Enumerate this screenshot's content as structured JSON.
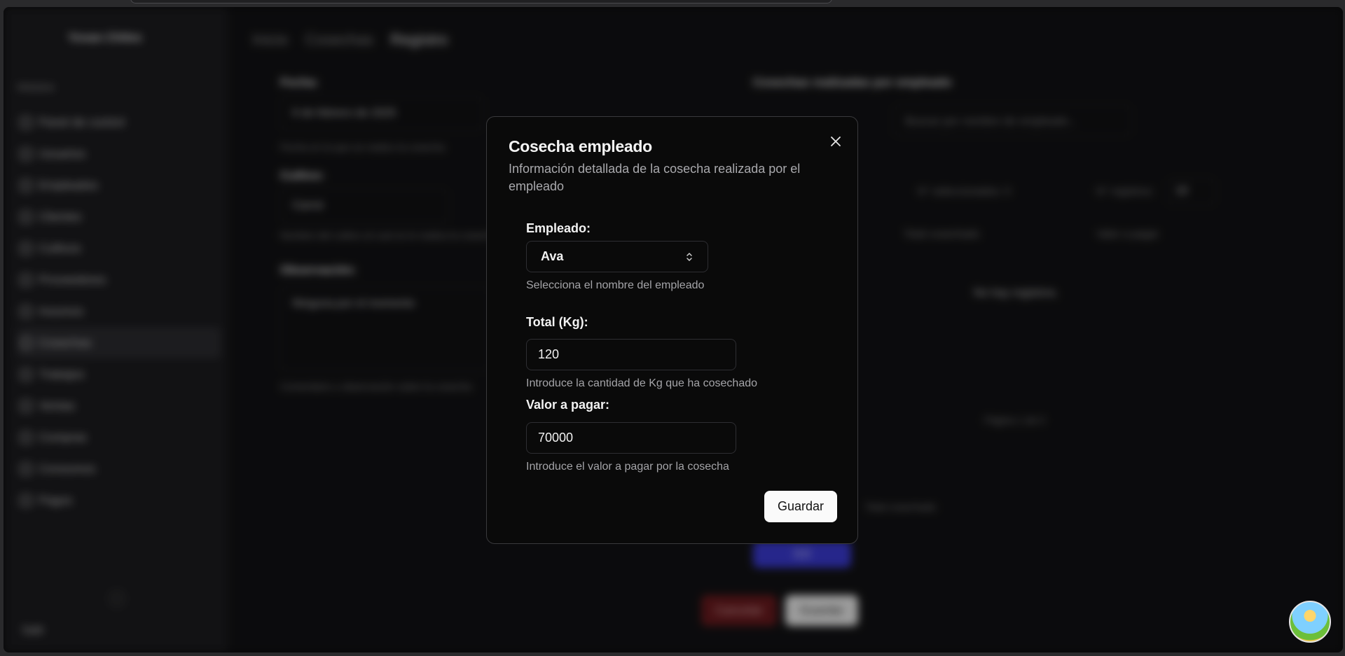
{
  "background": {
    "org_name": "Yovan Chiles",
    "sidebar_group": "Módulos",
    "nav": [
      {
        "label": "Panel de control",
        "active": false
      },
      {
        "label": "Usuarios",
        "active": false
      },
      {
        "label": "Empleados",
        "active": false
      },
      {
        "label": "Clientes",
        "active": false
      },
      {
        "label": "Cultivos",
        "active": false
      },
      {
        "label": "Proveedores",
        "active": false
      },
      {
        "label": "Insumos",
        "active": false
      },
      {
        "label": "Cosechas",
        "active": true
      },
      {
        "label": "Trabajos",
        "active": false
      },
      {
        "label": "Ventas",
        "active": false
      },
      {
        "label": "Compras",
        "active": false
      },
      {
        "label": "Consumos",
        "active": false
      },
      {
        "label": "Pagos",
        "active": false
      }
    ],
    "logout": "Salir",
    "breadcrumbs": [
      "Inicio",
      "Cosechas",
      "Registro"
    ],
    "form": {
      "fecha_label": "Fecha:",
      "fecha_value": "6 de febrero de 2025",
      "fecha_hint": "Fecha en la que se realizo la cosecha",
      "cultivo_label": "Cultivo:",
      "cultivo_value": "Carrot",
      "cultivo_hint": "Nombre del cultivo al cual se le realiza la cosecha",
      "obs_label": "Observación:",
      "obs_value": "Ninguna por el momento",
      "obs_hint": "Comentario u observación sobre la cosecha"
    },
    "right": {
      "title": "Cosechas realizadas por empleado",
      "search_placeholder": "Buscar por nombre de empleado...",
      "selected": "N° seleccionados: 0",
      "registros": "N° registros:",
      "registros_value": "10",
      "col_total": "Total cosechado",
      "col_valor": "Valor a pagar",
      "empty": "No hay registros.",
      "page": "Página 1 de 0",
      "summary_hint": "Total cosechado",
      "blue_button": "0.0"
    },
    "cancel_button": "Cancelar",
    "save_button": "Guardar"
  },
  "modal": {
    "title": "Cosecha empleado",
    "description": "Información detallada de la cosecha realizada por el empleado",
    "empleado_label": "Empleado:",
    "empleado_value": "Ava",
    "empleado_hint": "Selecciona el nombre del empleado",
    "total_label": "Total (Kg):",
    "total_value": "120",
    "total_hint": "Introduce la cantidad de Kg que ha cosechado",
    "valor_label": "Valor a pagar:",
    "valor_value": "70000",
    "valor_hint": "Introduce el valor a pagar por la cosecha",
    "save_label": "Guardar"
  },
  "colors": {
    "modal_bg": "#0a0a0a",
    "accent_blue": "#3b3bd6",
    "danger": "#6a1a1e"
  }
}
